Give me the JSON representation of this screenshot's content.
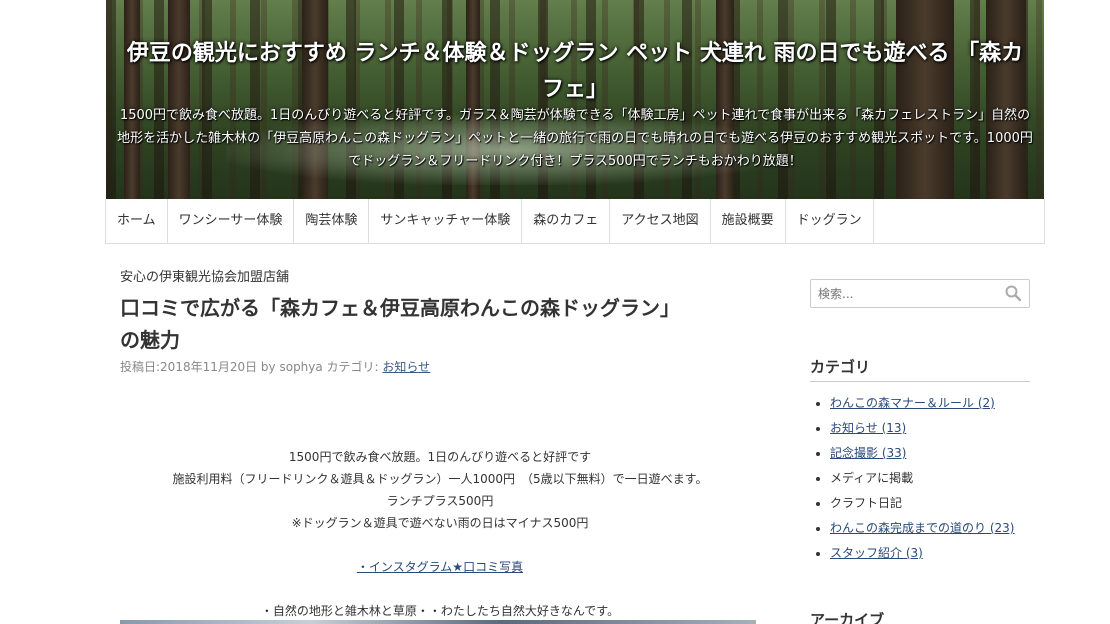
{
  "header": {
    "title": "伊豆の観光におすすめ ランチ＆体験＆ドッグラン ペット 犬連れ 雨の日でも遊べる 「森カフェ」",
    "description": "1500円で飲み食べ放題。1日のんびり遊べると好評です。ガラス＆陶芸が体験できる「体験工房」ペット連れで食事が出来る「森カフェレストラン」自然の地形を活かした雑木林の「伊豆高原わんこの森ドッグラン」ペットと一緒の旅行で雨の日でも晴れの日でも遊べる伊豆のおすすめ観光スポットです。1000円でドッグラン＆フリードリンク付き！プラス500円でランチもおかわり放題！"
  },
  "nav": {
    "items": [
      {
        "label": "ホーム"
      },
      {
        "label": "ワンシーサー体験"
      },
      {
        "label": "陶芸体験"
      },
      {
        "label": "サンキャッチャー体験"
      },
      {
        "label": "森のカフェ"
      },
      {
        "label": "アクセス地図"
      },
      {
        "label": "施設概要"
      },
      {
        "label": "ドッグラン"
      }
    ]
  },
  "post": {
    "kicker": "安心の伊東観光協会加盟店舗",
    "title_line1": "口コミで広がる「森カフェ＆伊豆高原わんこの森ドッグラン」",
    "title_line2": "の魅力",
    "meta_prefix": "投稿日:2018年11月20日 by sophya カテゴリ: ",
    "meta_category": "お知らせ",
    "lines": [
      "1500円で飲み食べ放題。1日のんびり遊べると好評です",
      "施設利用料（フリードリンク＆遊具＆ドッグラン）一人1000円　（5歳以下無料）で一日遊べます。",
      "ランチプラス500円",
      "※ドッグラン＆遊具で遊べない雨の日はマイナス500円"
    ],
    "instagram_link": "・インスタグラム★口コミ写真",
    "nature_line": "・自然の地形と雑木林と草原・・わたしたち自然大好きなんです。"
  },
  "sidebar": {
    "search_placeholder": "検索...",
    "categories_title": "カテゴリ",
    "categories": [
      {
        "label": "わんこの森マナー＆ルール (2)",
        "link": true
      },
      {
        "label": "お知らせ (13)",
        "link": true
      },
      {
        "label": "記念撮影 (33)",
        "link": true
      },
      {
        "label": "メディアに掲載",
        "link": false
      },
      {
        "label": "クラフト日記",
        "link": false
      },
      {
        "label": "わんこの森完成までの道のり (23)",
        "link": true
      },
      {
        "label": "スタッフ紹介 (3)",
        "link": true
      }
    ],
    "archive_title": "アーカイブ"
  },
  "colors": {
    "link": "#2b4a78",
    "meta": "#888888",
    "border": "#dddddd"
  }
}
